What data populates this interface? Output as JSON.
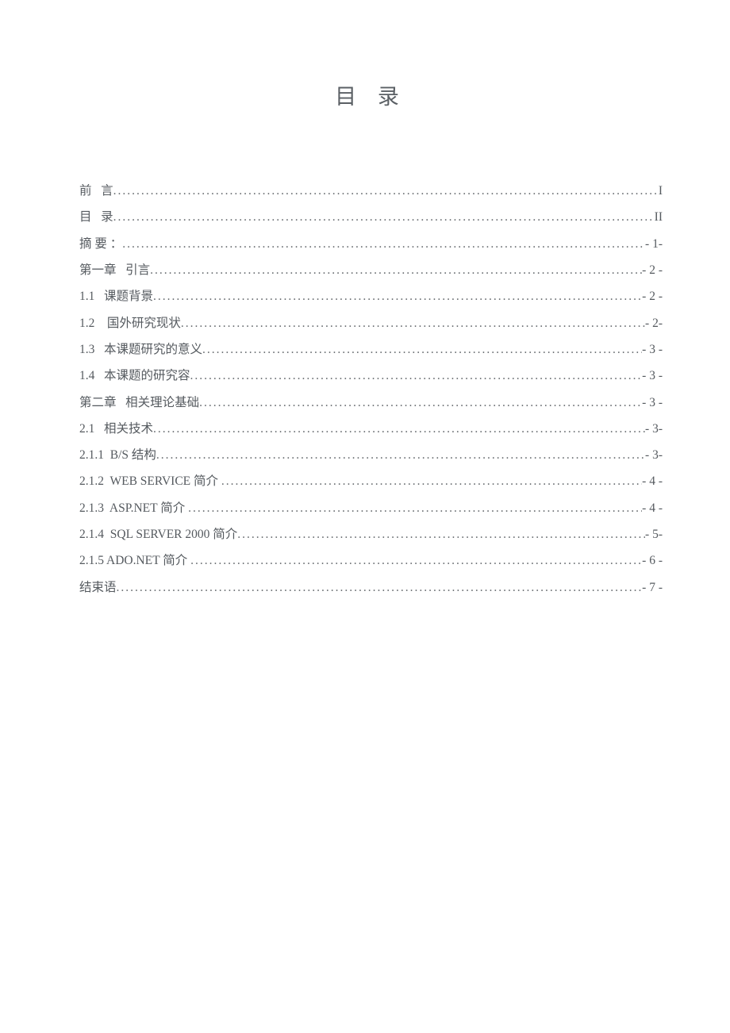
{
  "title": "目 录",
  "entries": [
    {
      "label": "前   言",
      "page": "I"
    },
    {
      "label": "目   录",
      "page": "II"
    },
    {
      "label": "摘 要 ：",
      "page": "- 1-"
    },
    {
      "label": "第一章   引言",
      "page": "- 2 -"
    },
    {
      "label": "1.1   课题背景",
      "page": "- 2 -"
    },
    {
      "label": "1.2    国外研究现状",
      "page": "- 2-"
    },
    {
      "label": "1.3   本课题研究的意义",
      "page": "- 3 -"
    },
    {
      "label": "1.4   本课题的研究容",
      "page": "- 3 -"
    },
    {
      "label": "第二章   相关理论基础",
      "page": "- 3 -"
    },
    {
      "label": "2.1   相关技术",
      "page": "- 3-"
    },
    {
      "label": "2.1.1  B/S 结构",
      "page": "- 3-"
    },
    {
      "label": "2.1.2  WEB SERVICE 简介 ",
      "page": "- 4 -"
    },
    {
      "label": "2.1.3  ASP.NET 简介 ",
      "page": "- 4 -"
    },
    {
      "label": "2.1.4  SQL SERVER 2000 简介",
      "page": "- 5-"
    },
    {
      "label": "2.1.5 ADO.NET 简介 ",
      "page": "- 6 -"
    },
    {
      "label": "结束语",
      "page": "- 7 -"
    }
  ]
}
